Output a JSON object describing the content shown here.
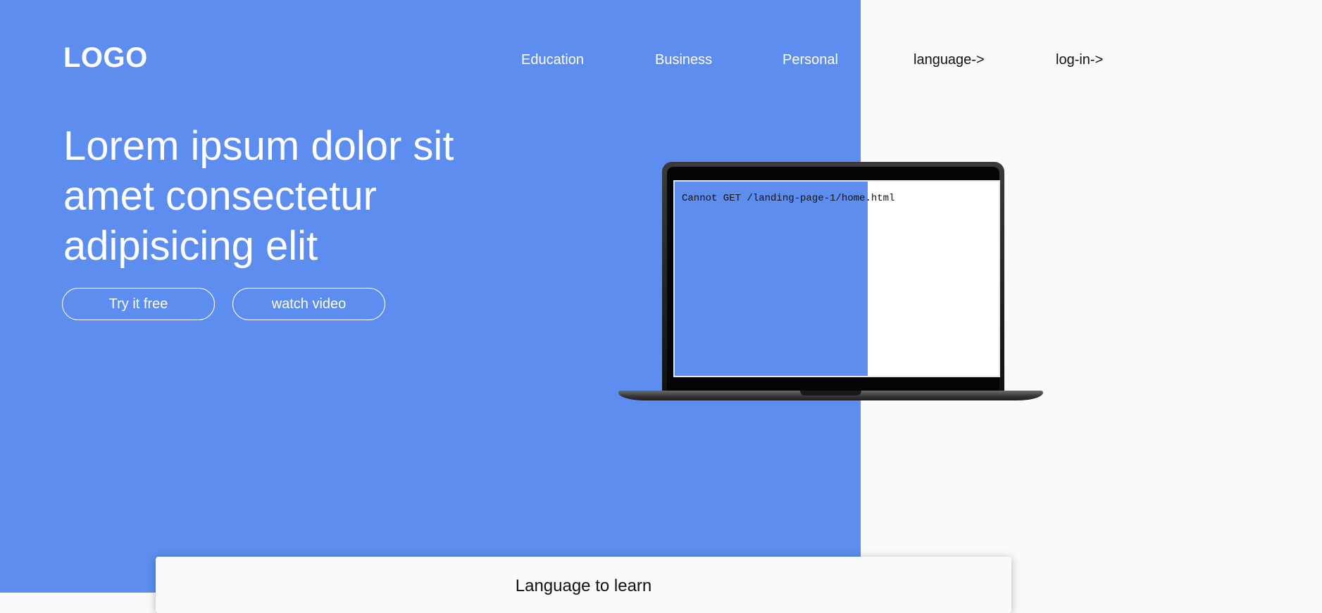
{
  "header": {
    "logo": "LOGO",
    "nav": {
      "education": "Education",
      "business": "Business",
      "personal": "Personal",
      "language": "language->",
      "login": "log-in->"
    }
  },
  "hero": {
    "title": "Lorem ipsum dolor sit amet consectetur adipisicing elit",
    "try_button": "Try it free",
    "video_button": "watch video"
  },
  "laptop": {
    "screen_text": "Cannot GET /landing-page-1/home.html"
  },
  "language_section": {
    "title": "Language to learn"
  },
  "colors": {
    "accent": "#5c8def",
    "background": "#f9fafc",
    "text_dark": "#111111"
  }
}
